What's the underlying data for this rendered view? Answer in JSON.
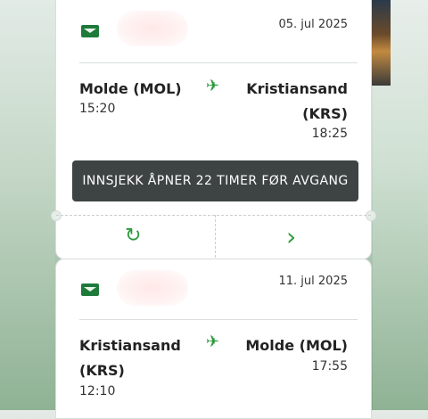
{
  "trips": [
    {
      "date": "05. jul 2025",
      "from_city": "Molde (MOL)",
      "from_time": "15:20",
      "to_city_line1": "Kristiansand",
      "to_city_line2": "(KRS)",
      "to_time": "18:25",
      "checkin_label": "INNSJEKK ÅPNER 22 TIMER FØR AVGANG",
      "refresh_icon": "↻",
      "next_icon": "›"
    },
    {
      "date": "11. jul 2025",
      "from_city_line1": "Kristiansand",
      "from_city_line2": "(KRS)",
      "from_time": "12:10",
      "to_city": "Molde (MOL)",
      "to_time": "17:55"
    }
  ],
  "plane_icon": "✈",
  "colors": {
    "accent": "#2e9a3e",
    "button": "#3e4344",
    "flag": "#1e7a3a"
  }
}
